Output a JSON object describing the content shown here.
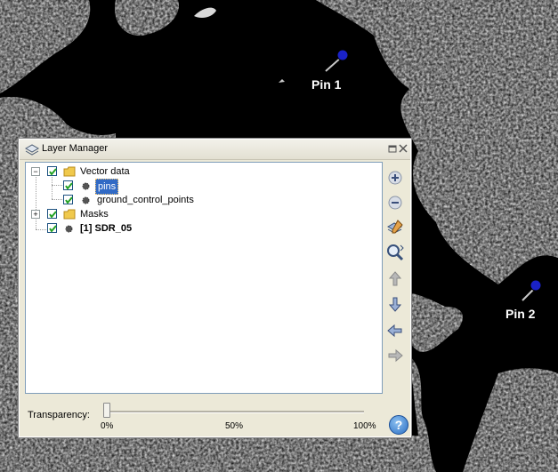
{
  "map": {
    "pins": [
      {
        "label": "Pin 1"
      },
      {
        "label": "Pin 2"
      }
    ]
  },
  "layer_manager": {
    "title": "Layer Manager",
    "tree": [
      {
        "label": "Vector data",
        "checked": true,
        "expanded": true,
        "icon": "folder-icon"
      },
      {
        "label": "pins",
        "checked": true,
        "selected": true,
        "icon": "vector-layer-icon"
      },
      {
        "label": "ground_control_points",
        "checked": true,
        "icon": "vector-layer-icon"
      },
      {
        "label": "Masks",
        "checked": true,
        "expanded": false,
        "icon": "folder-icon"
      },
      {
        "label": "[1] SDR_05",
        "checked": true,
        "bold": true,
        "icon": "raster-layer-icon"
      }
    ],
    "side_buttons": [
      "add-layer",
      "remove-layer",
      "open-layer-editor",
      "zoom-to-layer",
      "move-layer-up",
      "move-layer-down",
      "move-layer-left",
      "move-layer-right"
    ],
    "transparency": {
      "label": "Transparency:",
      "value": 0,
      "ticks": [
        "0%",
        "50%",
        "100%"
      ]
    },
    "help_label": "?"
  }
}
